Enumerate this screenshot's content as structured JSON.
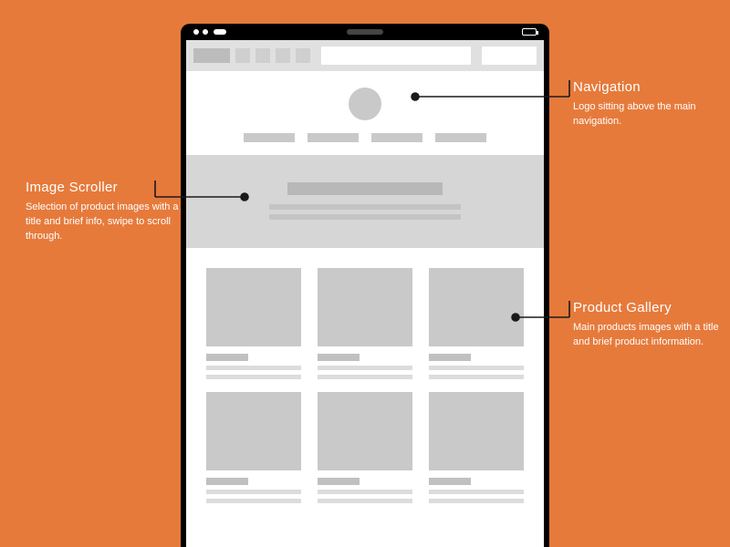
{
  "annotations": {
    "navigation": {
      "title": "Navigation",
      "body": "Logo sitting above the main navigation."
    },
    "scroller": {
      "title": "Image Scroller",
      "body": "Selection of product images with a title and brief info, swipe to scroll through."
    },
    "gallery": {
      "title": "Product Gallery",
      "body": "Main products images with a title and brief product information."
    }
  }
}
